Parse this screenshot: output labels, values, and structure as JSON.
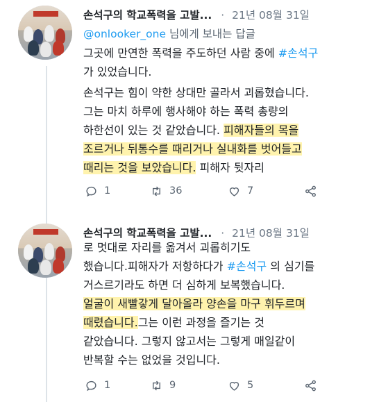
{
  "tweets": [
    {
      "author": "손석구의 학교폭력을 고발...",
      "date": "21년 08월 31일",
      "separator": "·",
      "reply_to_handle": "@onlooker_one",
      "reply_suffix": "님에게 보내는 답글",
      "lines": [
        {
          "a": "그곳에 만연한 폭력을 주도하던 사람 중에 ",
          "tag": "#손석구"
        },
        {
          "a": "가 있었습니다."
        },
        {
          "a": "손석구는 힘이 약한 상대만 골라서 괴롭혔습니다."
        },
        {
          "a": "그는 마치 하루에 행사해야 하는 폭력 총량의"
        },
        {
          "a": "하한선이 있는 것 같았습니다. ",
          "hl": "피해자들의 목을"
        },
        {
          "hl": "조르거나 뒤통수를 때리거나 실내화를 벗어들고"
        },
        {
          "hl": "때리는 것을 보았습니다.",
          "b": " 피해자 뒷자리"
        }
      ],
      "replies": "1",
      "retweets": "36",
      "likes": "7"
    },
    {
      "author": "손석구의 학교폭력을 고발...",
      "date": "21년 08월 31일",
      "separator": "·",
      "lines": [
        {
          "a": "로 멋대로 자리를 옮겨서 괴롭히기도"
        },
        {
          "a": "했습니다.피해자가 저항하다가 ",
          "tag": "#손석구",
          "b": " 의 심기를"
        },
        {
          "a": "거스르기라도 하면 더 심하게 보복했습니다."
        },
        {
          "hl": "얼굴이 새빨갛게 달아올라 양손을 마구 휘두르며"
        },
        {
          "hl": "때렸습니다.",
          "b": "그는 이런 과정을 즐기는 것"
        },
        {
          "a": "같았습니다. 그렇지 않고서는 그렇게 매일같이"
        },
        {
          "a": "반복할 수는 없었을 것입니다."
        }
      ],
      "replies": "1",
      "retweets": "9",
      "likes": "5"
    }
  ],
  "icons": {
    "reply": "reply-icon",
    "retweet": "retweet-icon",
    "like": "heart-icon",
    "share": "share-icon",
    "avatar": "avatar"
  },
  "colors": {
    "hashtag": "#1d9bf0",
    "highlight": "#fff3ad",
    "muted": "#6b7785",
    "thread_line": "#dde3e8"
  }
}
